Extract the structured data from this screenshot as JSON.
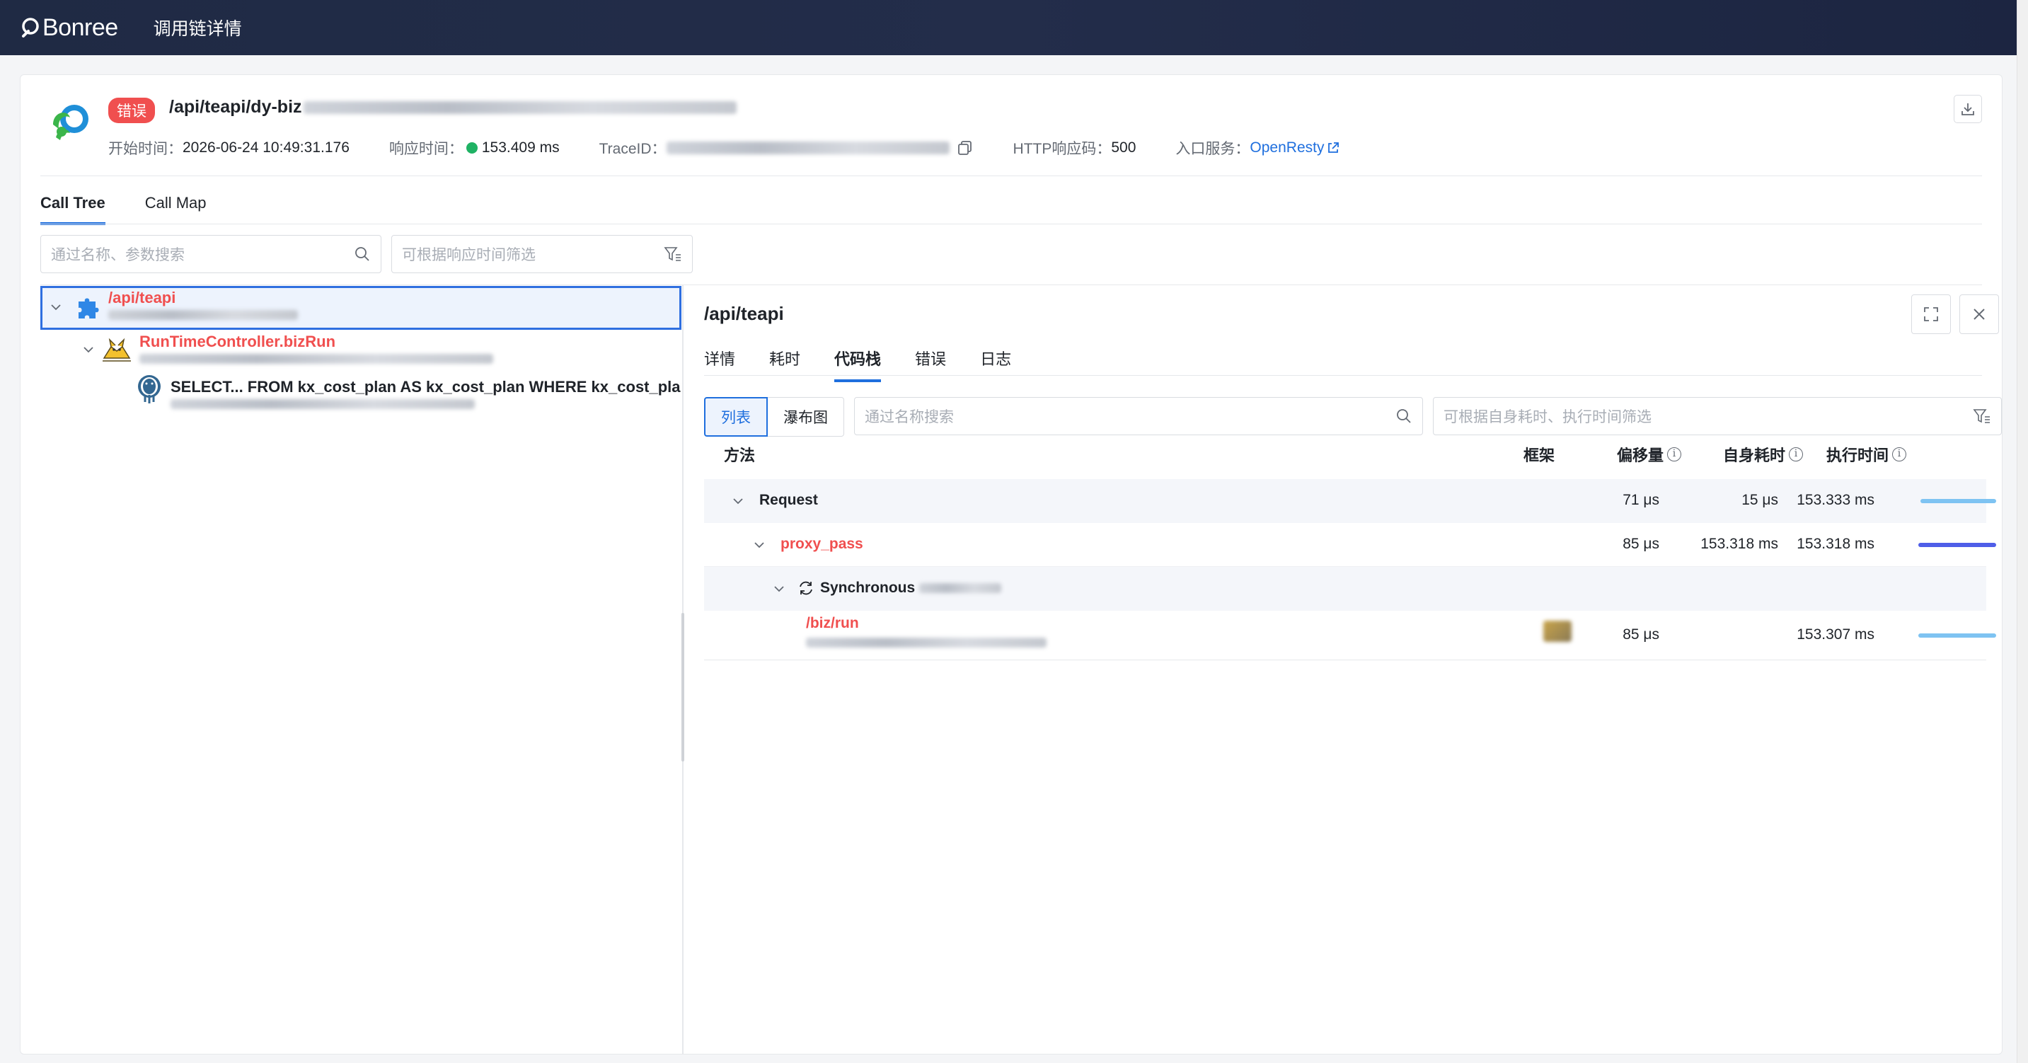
{
  "topbar": {
    "logo_text": "Bonree",
    "title": "调用链详情"
  },
  "header": {
    "status_badge": "错误",
    "url": "/api/teapi/dy-biz",
    "start_time_label": "开始时间：",
    "start_time": "2026-06-24 10:49:31.176",
    "response_time_label": "响应时间：",
    "response_time": "153.409 ms",
    "traceid_label": "TraceID：",
    "http_code_label": "HTTP响应码：",
    "http_code": "500",
    "entry_service_label": "入口服务：",
    "entry_service": "OpenResty"
  },
  "main_tabs": [
    {
      "label": "Call Tree",
      "active": true
    },
    {
      "label": "Call Map",
      "active": false
    }
  ],
  "left_search": {
    "name_placeholder": "通过名称、参数搜索",
    "filter_placeholder": "可根据响应时间筛选"
  },
  "tree": [
    {
      "name": "/api/teapi",
      "icon": "puzzle-icon"
    },
    {
      "name": "RunTimeController.bizRun",
      "icon": "tomcat-icon"
    },
    {
      "name": "SELECT... FROM kx_cost_plan AS kx_cost_plan WHERE kx_cost_plan",
      "icon": "postgresql-icon"
    }
  ],
  "right_panel": {
    "title": "/api/teapi",
    "tabs": [
      {
        "label": "详情",
        "active": false
      },
      {
        "label": "耗时",
        "active": false
      },
      {
        "label": "代码栈",
        "active": true
      },
      {
        "label": "错误",
        "active": false
      },
      {
        "label": "日志",
        "active": false
      }
    ],
    "view_modes": [
      {
        "label": "列表",
        "active": true
      },
      {
        "label": "瀑布图",
        "active": false
      }
    ],
    "search_placeholder": "通过名称搜索",
    "filter_placeholder": "可根据自身耗时、执行时间筛选",
    "columns": {
      "method": "方法",
      "framework": "框架",
      "offset": "偏移量",
      "self_time": "自身耗时",
      "exec_time": "执行时间"
    },
    "rows": [
      {
        "method": "Request",
        "offset": "71 μs",
        "self_time": "15 μs",
        "exec_time": "153.333 ms",
        "bar_color": "#7ec3f2",
        "bar_fraction": 0.97
      },
      {
        "method": "proxy_pass",
        "offset": "85 μs",
        "self_time": "153.318 ms",
        "exec_time": "153.318 ms",
        "bar_color": "#4f5ee8",
        "bar_fraction": 1.0
      },
      {
        "method": "Synchronous",
        "offset": "",
        "self_time": "",
        "exec_time": "",
        "bar_color": "",
        "bar_fraction": 0
      },
      {
        "method": "/biz/run",
        "offset": "85 μs",
        "self_time": "",
        "exec_time": "153.307 ms",
        "bar_color": "#7ec3f2",
        "bar_fraction": 1.0
      }
    ]
  }
}
